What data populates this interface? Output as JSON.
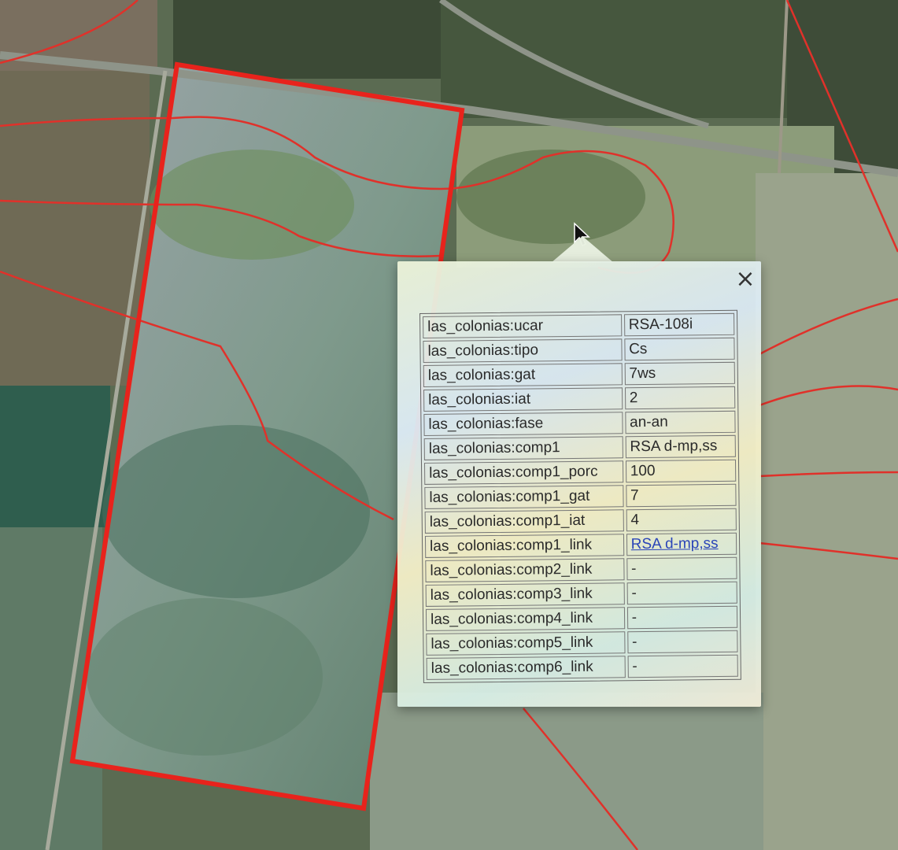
{
  "popup": {
    "close_icon": "close-icon",
    "rows": [
      {
        "key": "las_colonias:ucar",
        "value": "RSA-108i",
        "link": false
      },
      {
        "key": "las_colonias:tipo",
        "value": "Cs",
        "link": false
      },
      {
        "key": "las_colonias:gat",
        "value": "7ws",
        "link": false
      },
      {
        "key": "las_colonias:iat",
        "value": "2",
        "link": false
      },
      {
        "key": "las_colonias:fase",
        "value": "an-an",
        "link": false
      },
      {
        "key": "las_colonias:comp1",
        "value": "RSA d-mp,ss",
        "link": false
      },
      {
        "key": "las_colonias:comp1_porc",
        "value": "100",
        "link": false
      },
      {
        "key": "las_colonias:comp1_gat",
        "value": "7",
        "link": false
      },
      {
        "key": "las_colonias:comp1_iat",
        "value": "4",
        "link": false
      },
      {
        "key": "las_colonias:comp1_link",
        "value": "RSA d-mp,ss",
        "link": true
      },
      {
        "key": "las_colonias:comp2_link",
        "value": "-",
        "link": false
      },
      {
        "key": "las_colonias:comp3_link",
        "value": "-",
        "link": false
      },
      {
        "key": "las_colonias:comp4_link",
        "value": "-",
        "link": false
      },
      {
        "key": "las_colonias:comp5_link",
        "value": "-",
        "link": false
      },
      {
        "key": "las_colonias:comp6_link",
        "value": "-",
        "link": false
      }
    ]
  },
  "colors": {
    "parcel_outline": "#e8231c",
    "boundary_lines": "#e0312a",
    "link": "#2a44b8"
  }
}
